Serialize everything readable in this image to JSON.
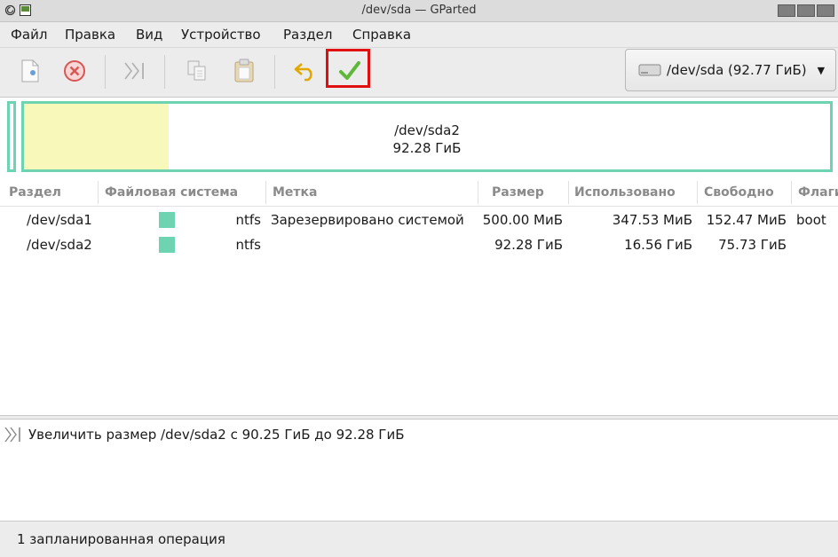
{
  "window": {
    "title": "/dev/sda — GParted"
  },
  "menu": [
    "Файл",
    "Правка",
    "Вид",
    "Устройство",
    "Раздел",
    "Справка"
  ],
  "toolbar": {
    "items": [
      "new",
      "delete",
      "resize-move",
      "copy",
      "paste",
      "undo",
      "apply"
    ],
    "highlight": "apply",
    "highlight_color": "#e01010"
  },
  "device": {
    "label": "/dev/sda (92.77 ГиБ)"
  },
  "disk_map": {
    "partitions": [
      {
        "name": "/dev/sda1",
        "used_fraction": 0.695
      },
      {
        "name": "/dev/sda2",
        "label_name": "/dev/sda2",
        "label_size": "92.28 ГиБ",
        "used_fraction": 0.179
      }
    ],
    "border_color": "#6dd3b0",
    "used_color": "#f8f8bb"
  },
  "table": {
    "columns": [
      "Раздел",
      "Файловая система",
      "Метка",
      "Размер",
      "Использовано",
      "Свободно",
      "Флаги"
    ],
    "rows": [
      {
        "partition": "/dev/sda1",
        "fs": "ntfs",
        "fs_color": "#6dd3b0",
        "label": "Зарезервировано системой",
        "size": "500.00 МиБ",
        "used": "347.53 МиБ",
        "free": "152.47 МиБ",
        "flags": "boot"
      },
      {
        "partition": "/dev/sda2",
        "fs": "ntfs",
        "fs_color": "#6dd3b0",
        "label": "",
        "size": "92.28 ГиБ",
        "used": "16.56 ГиБ",
        "free": "75.73 ГиБ",
        "flags": ""
      }
    ]
  },
  "operations": [
    {
      "icon": "resize-icon",
      "text": "Увеличить размер /dev/sda2 с 90.25 ГиБ до 92.28 ГиБ"
    }
  ],
  "status": {
    "text": "1 запланированная операция"
  }
}
